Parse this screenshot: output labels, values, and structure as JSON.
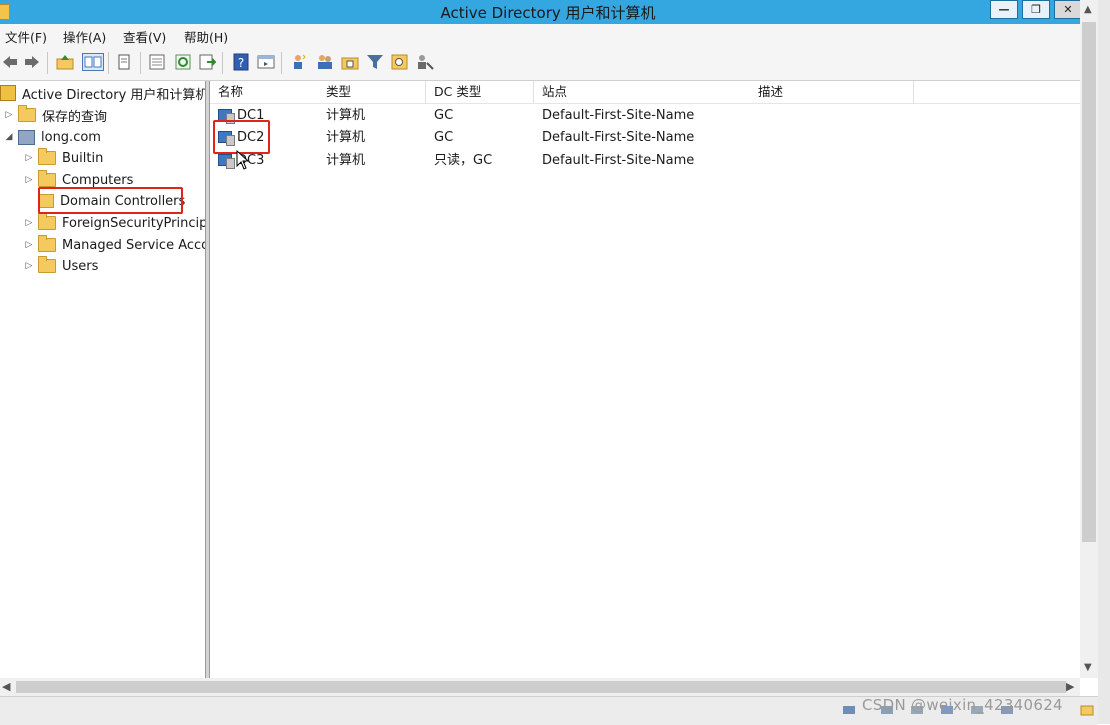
{
  "window": {
    "title": "Active Directory 用户和计算机",
    "buttons": {
      "minimize": "—",
      "maximize": "❐",
      "close": "✕"
    }
  },
  "menu": [
    "文件(F)",
    "操作(A)",
    "查看(V)",
    "帮助(H)"
  ],
  "toolbar": {
    "icons": [
      "back-icon",
      "forward-icon",
      "up-folder-icon",
      "console-tree-icon",
      "copy-icon",
      "properties-icon",
      "refresh-icon",
      "export-icon",
      "help-icon",
      "mmc-view-icon",
      "new-user-icon",
      "new-group-icon",
      "new-ou-icon",
      "filter-icon",
      "find-icon",
      "add-to-group-icon"
    ]
  },
  "tree": {
    "root": "Active Directory 用户和计算机",
    "saved_queries": "保存的查询",
    "domain": "long.com",
    "children": [
      "Builtin",
      "Computers",
      "Domain Controllers",
      "ForeignSecurityPrincipals",
      "Managed Service Accounts",
      "Users"
    ],
    "selected": "Domain Controllers"
  },
  "list": {
    "columns": [
      "名称",
      "类型",
      "DC 类型",
      "站点",
      "描述"
    ],
    "rows": [
      {
        "name": "DC1",
        "type": "计算机",
        "dc_type": "GC",
        "site": "Default-First-Site-Name",
        "desc": ""
      },
      {
        "name": "DC2",
        "type": "计算机",
        "dc_type": "GC",
        "site": "Default-First-Site-Name",
        "desc": ""
      },
      {
        "name": "DC3",
        "type": "计算机",
        "dc_type": "只读，GC",
        "site": "Default-First-Site-Name",
        "desc": ""
      }
    ],
    "highlighted": "DC2"
  },
  "watermark": "CSDN @weixin_42340624",
  "colors": {
    "titlebar": "#34a6e0",
    "highlight": "#e2231a"
  }
}
